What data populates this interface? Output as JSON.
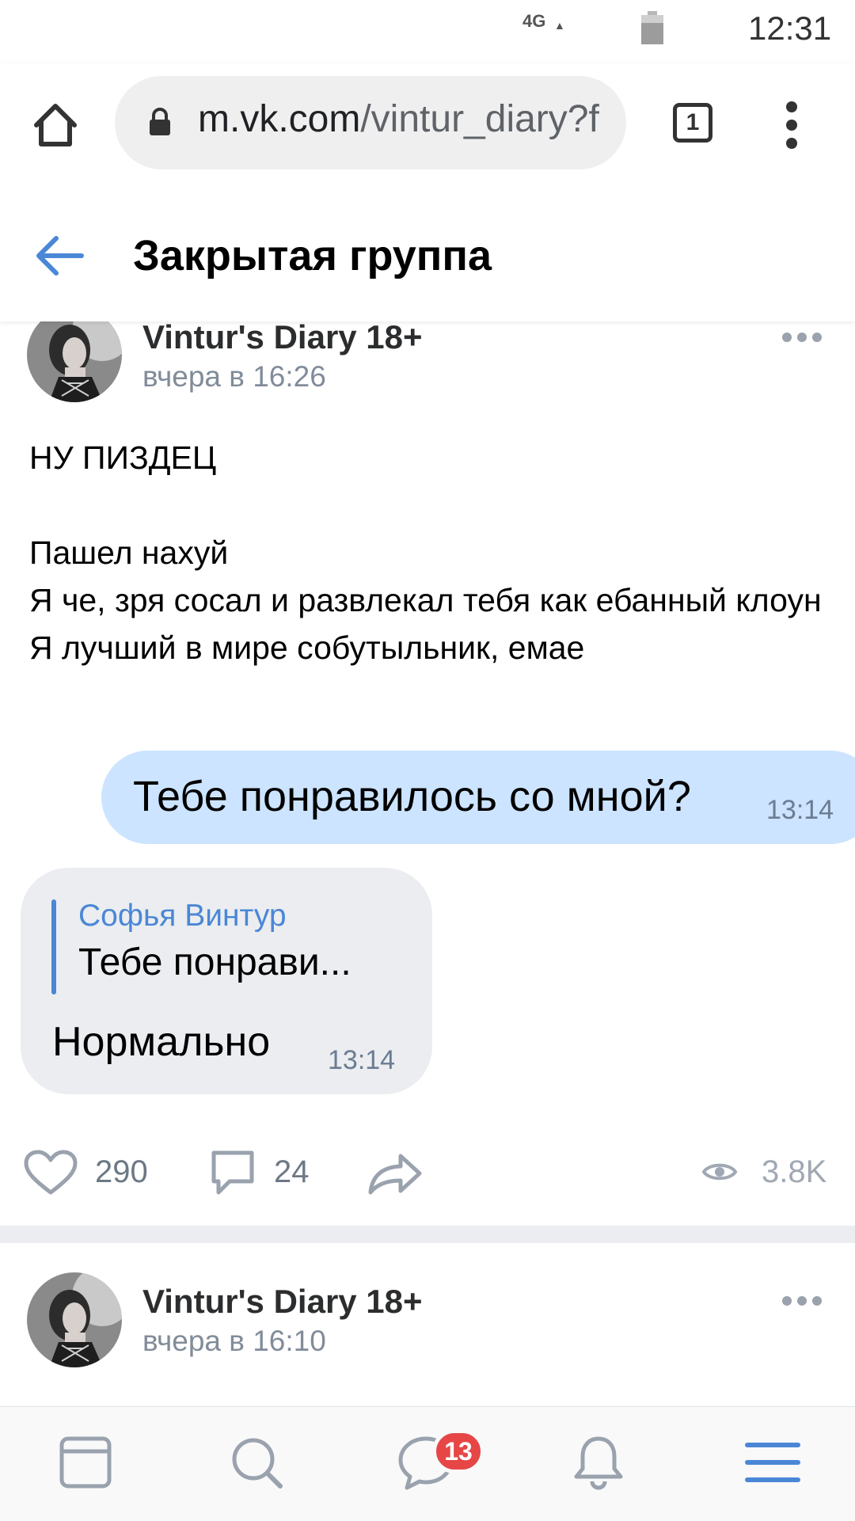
{
  "status_bar": {
    "network": "4G",
    "time": "12:31"
  },
  "browser": {
    "url_domain": "m.vk.com",
    "url_path": "/vintur_diary?f",
    "tab_count": "1"
  },
  "header": {
    "title": "Закрытая группа"
  },
  "posts": [
    {
      "author": "Vintur's Diary 18+",
      "time": "вчера в 16:26",
      "text": "НУ ПИЗДЕЦ\n\nПашел нахуй\nЯ че, зря сосал и развлекал тебя как ебанный клоун\nЯ лучший в мире собутыльник, емае",
      "screenshot": {
        "outgoing_message": "Тебе понравилось со мной?",
        "outgoing_time": "13:14",
        "reply_to_name": "Софья Винтур",
        "reply_to_text": "Тебе понрави...",
        "incoming_message": "Нормально",
        "incoming_time": "13:14"
      },
      "likes": "290",
      "comments": "24",
      "views": "3.8K"
    },
    {
      "author": "Vintur's Diary 18+",
      "time": "вчера в 16:10"
    }
  ],
  "bottom_nav": {
    "messages_badge": "13"
  },
  "colors": {
    "accent": "#4a87d6",
    "outgoing_bubble": "#cce4ff",
    "incoming_bubble": "#ebedf0",
    "badge": "#e64646"
  },
  "icons": [
    "home-icon",
    "lock-icon",
    "tabs-icon",
    "more-vert-icon",
    "back-arrow-icon",
    "more-horizontal-icon",
    "heart-icon",
    "comment-icon",
    "share-icon",
    "eye-icon",
    "news-feed-icon",
    "search-icon",
    "messages-icon",
    "notifications-icon",
    "menu-icon"
  ]
}
